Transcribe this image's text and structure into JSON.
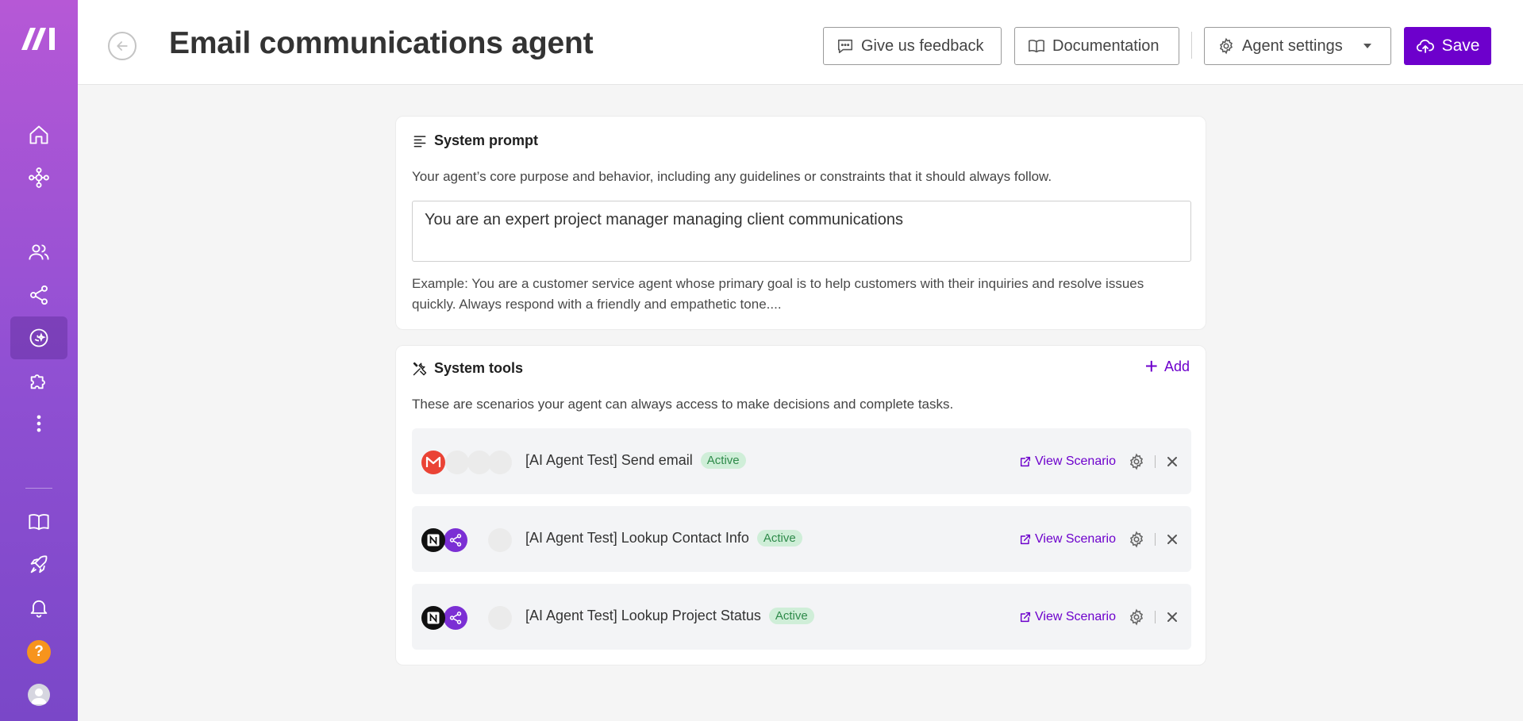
{
  "header": {
    "title": "Email communications agent",
    "feedback_label": "Give us feedback",
    "docs_label": "Documentation",
    "settings_label": "Agent settings",
    "save_label": "Save"
  },
  "system_prompt": {
    "title": "System prompt",
    "description": "Your agent’s core purpose and behavior, including any guidelines or constraints that it should always follow.",
    "value": "You are an expert project manager managing client communications",
    "example": "Example: You are a customer service agent whose primary goal is to help customers with their inquiries and resolve issues quickly. Always respond with a friendly and empathetic tone...."
  },
  "system_tools": {
    "title": "System tools",
    "add_label": "Add",
    "description": "These are scenarios your agent can always access to make decisions and complete tasks.",
    "view_label": "View Scenario",
    "tools": [
      {
        "name": "[AI Agent Test] Send email",
        "status": "Active",
        "apps": [
          "gmail-icon"
        ]
      },
      {
        "name": "[AI Agent Test] Lookup Contact Info",
        "status": "Active",
        "apps": [
          "notion-icon",
          "share-icon"
        ]
      },
      {
        "name": "[AI Agent Test] Lookup Project Status",
        "status": "Active",
        "apps": [
          "notion-icon",
          "share-icon"
        ]
      }
    ]
  },
  "colors": {
    "accent": "#6d00cc",
    "active_badge_bg": "#cfeed8",
    "active_badge_text": "#2e8a4a",
    "gmail": "#ea4335",
    "help": "#f7941d"
  }
}
